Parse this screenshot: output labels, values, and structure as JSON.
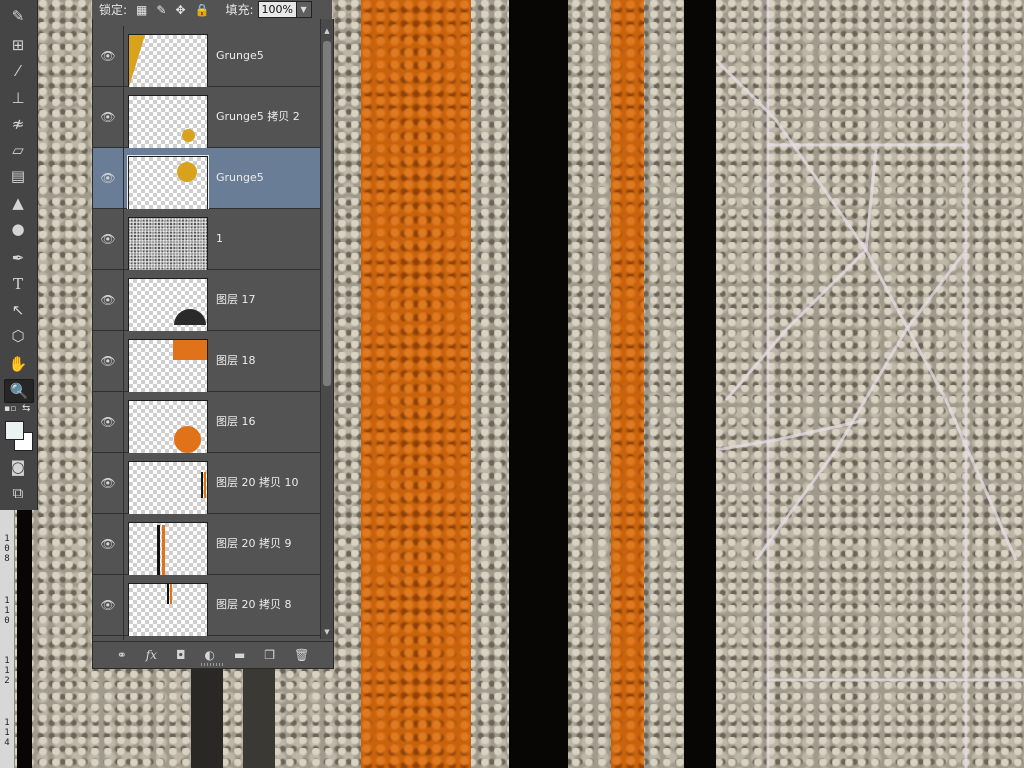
{
  "options_bar": {
    "lock_label": "锁定:",
    "fill_label": "填充:",
    "fill_value": "100%"
  },
  "layers": [
    {
      "name": "Grunge5"
    },
    {
      "name": "Grunge5 拷贝 2"
    },
    {
      "name": "Grunge5",
      "selected": true
    },
    {
      "name": "1"
    },
    {
      "name": "图层 17"
    },
    {
      "name": "图层 18"
    },
    {
      "name": "图层 16"
    },
    {
      "name": "图层 20 拷贝 10"
    },
    {
      "name": "图层 20 拷贝 9"
    },
    {
      "name": "图层 20 拷贝 8"
    }
  ],
  "ruler_ticks": [
    "108",
    "110",
    "112",
    "114"
  ],
  "colors": {
    "orange": "#c8620c",
    "selection": "#6a7d96",
    "panel": "#535353"
  }
}
